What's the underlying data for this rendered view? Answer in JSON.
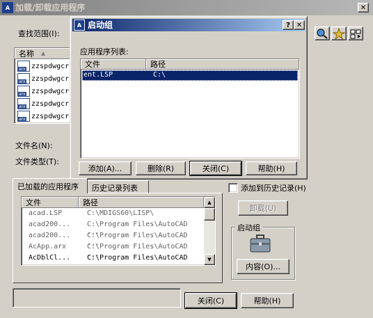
{
  "main": {
    "title": "加载/卸载应用程序",
    "app_icon": "autocad-icon",
    "close_glyph": "✕",
    "lookin_label": "查找范围(I):",
    "list_header": "名称",
    "files": [
      "zzspdwgcr",
      "zzspdwgcr",
      "zzspdwgcr",
      "zzspdwgcr",
      "zzspdwgcr"
    ],
    "filename_label": "文件名(N):",
    "filetype_label": "文件类型(T):",
    "tabs": [
      "已加载的应用程序",
      "历史记录列表"
    ],
    "add_to_history": "添加到历史记录(H)",
    "loaded_headers": [
      "文件",
      "路径"
    ],
    "loaded": [
      {
        "file": "acad.LSP",
        "path": "C:\\MDIGS60\\LISP\\"
      },
      {
        "file": "acad200...",
        "path": "C:\\Program Files\\AutoCAD ..."
      },
      {
        "file": "acad200...",
        "path": "C:\\Program Files\\AutoCAD ..."
      },
      {
        "file": "AcApp.arx",
        "path": "C:\\Program Files\\AutoCAD ..."
      },
      {
        "file": "AcDblCl...",
        "path": "C:\\Program Files\\AutoCAD ..."
      }
    ],
    "unload": "卸载(U)",
    "startup_group": "启动组",
    "contents": "内容(O)...",
    "close": "关闭(C)",
    "help": "帮助(H)"
  },
  "startup": {
    "title": "启动组",
    "help_glyph": "?",
    "close_glyph": "✕",
    "list_label": "应用程序列表:",
    "headers": [
      "文件",
      "路径"
    ],
    "rows": [
      {
        "file": "ent.LSP",
        "path": "C:\\"
      }
    ],
    "add": "添加(A)...",
    "remove": "删除(R)",
    "close": "关闭(C)",
    "help": "帮助(H)"
  },
  "colors": {
    "title_active": "#0a246a",
    "title_inactive": "#808080",
    "selection": "#0a246a"
  }
}
